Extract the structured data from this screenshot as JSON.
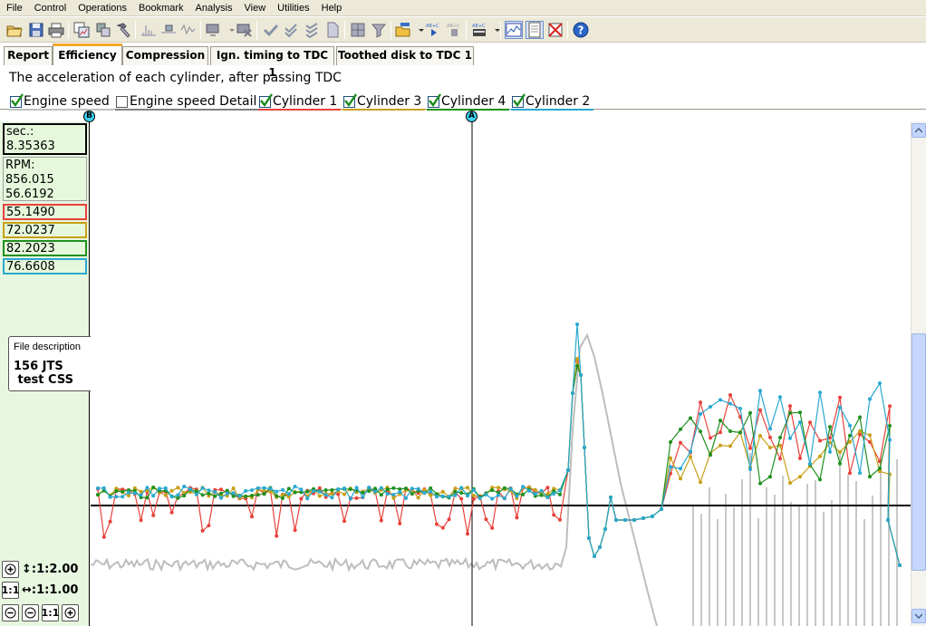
{
  "menu": [
    "File",
    "Control",
    "Operations",
    "Bookmark",
    "Analysis",
    "View",
    "Utilities",
    "Help"
  ],
  "toolbar_icons": [
    "open-icon",
    "save-icon",
    "print-icon",
    "copy-chart-icon",
    "layers-icon",
    "hammer-icon",
    "peak-icon",
    "cursor-pin-icon",
    "waveform-icon",
    "monitor-dropdown-icon",
    "monitor-remove-icon",
    "check-icon",
    "double-check-icon",
    "triple-check-icon",
    "document-icon",
    "grid-icon",
    "filter-icon",
    "open-sequence-icon",
    "step-sequence-icon",
    "stop-sequence-icon",
    "calculator-icon",
    "chart-view-icon",
    "page-view-icon",
    "delete-view-icon",
    "help-icon"
  ],
  "tabs": [
    {
      "label": "Report",
      "active": false
    },
    {
      "label": "Efficiency",
      "active": true
    },
    {
      "label": "Compression",
      "active": false
    },
    {
      "label": "Ign. timing to TDC 1",
      "active": false
    },
    {
      "label": "Toothed disk to TDC 1",
      "active": false
    }
  ],
  "subtitle": "The acceleration of each cylinder, after passing TDC",
  "legend": [
    {
      "label": "Engine speed",
      "checked": true,
      "color": "#c0c0c0"
    },
    {
      "label": "Engine speed Detail",
      "checked": false,
      "color": "#808080"
    },
    {
      "label": "Cylinder 1",
      "checked": true,
      "color": "#e8423a"
    },
    {
      "label": "Cylinder 3",
      "checked": true,
      "color": "#c8a018"
    },
    {
      "label": "Cylinder 4",
      "checked": true,
      "color": "#209020"
    },
    {
      "label": "Cylinder 2",
      "checked": true,
      "color": "#2aa8d0"
    }
  ],
  "readout": {
    "time_label": "sec.:",
    "time_value": "8.35363",
    "rpm_label": "RPM:",
    "rpm_value_1": "856.015",
    "rpm_value_2": "56.6192",
    "cyl1": "55.1490",
    "cyl3": "72.0237",
    "cyl4": "82.2023",
    "cyl2": "76.6608"
  },
  "file_description": {
    "title": "File description",
    "line1": "156 JTS",
    "line2": " test CSS"
  },
  "zoom": {
    "vertical": "1:2.00",
    "horizontal": "1:1.00",
    "reset_label": "1:1",
    "vertical_symbol": "↕",
    "horizontal_symbol": "↔"
  },
  "cursors": {
    "a": "A",
    "b": "B"
  },
  "colors": {
    "cyl1": "#e8423a",
    "cyl3": "#c8a018",
    "cyl4": "#209020",
    "cyl2": "#2aa8d0",
    "engine": "#bdbdbd"
  }
}
